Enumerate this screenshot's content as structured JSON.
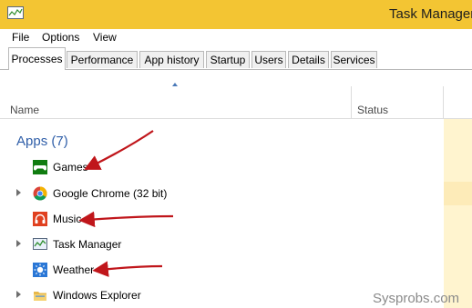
{
  "window": {
    "title": "Task Manager"
  },
  "menu": [
    "File",
    "Options",
    "View"
  ],
  "tabs": [
    {
      "label": "Processes",
      "active": true
    },
    {
      "label": "Performance",
      "active": false
    },
    {
      "label": "App history",
      "active": false
    },
    {
      "label": "Startup",
      "active": false
    },
    {
      "label": "Users",
      "active": false
    },
    {
      "label": "Details",
      "active": false
    },
    {
      "label": "Services",
      "active": false
    }
  ],
  "columns": {
    "name": "Name",
    "status": "Status"
  },
  "group": {
    "title": "Apps (7)"
  },
  "apps": [
    {
      "label": "Games",
      "icon": "games-icon",
      "expandable": false
    },
    {
      "label": "Google Chrome (32 bit)",
      "icon": "chrome-icon",
      "expandable": true
    },
    {
      "label": "Music",
      "icon": "music-icon",
      "expandable": false
    },
    {
      "label": "Task Manager",
      "icon": "task-manager-icon",
      "expandable": true
    },
    {
      "label": "Weather",
      "icon": "weather-icon",
      "expandable": false
    },
    {
      "label": "Windows Explorer",
      "icon": "explorer-icon",
      "expandable": true
    }
  ],
  "watermark": "Sysprobs.com",
  "colors": {
    "titlebar": "#f3c533",
    "group_title": "#2f5ea8",
    "annotation_arrow": "#c0161b",
    "status_column": "#fff4cf"
  }
}
